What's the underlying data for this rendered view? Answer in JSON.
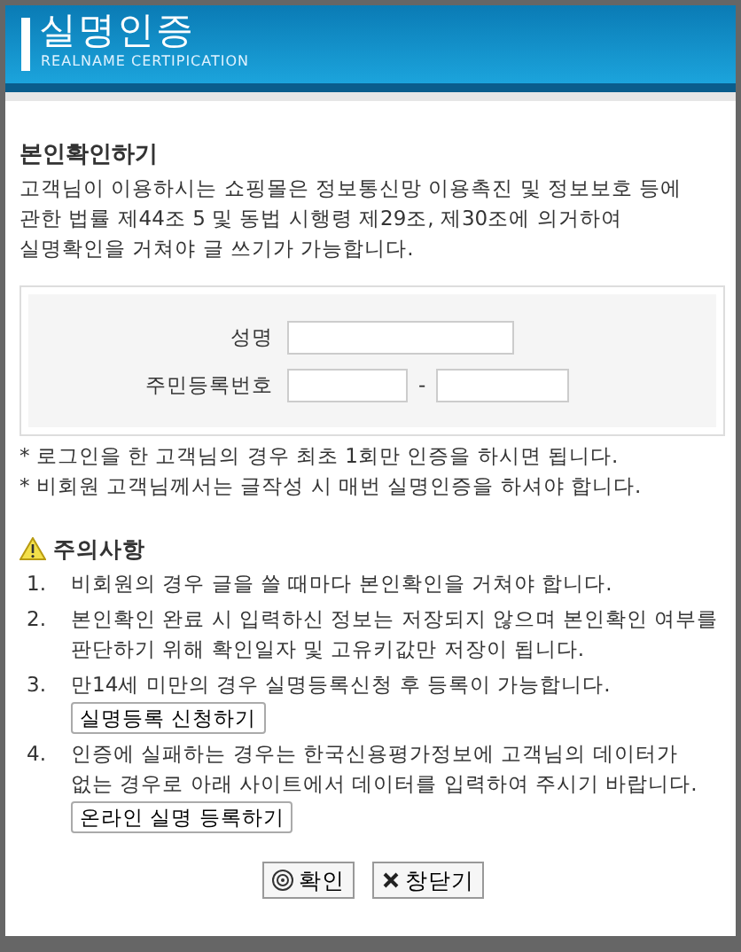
{
  "header": {
    "title": "실명인증",
    "subtitle": "REALNAME CERTIPICATION"
  },
  "section": {
    "heading": "본인확인하기",
    "intro_lines": [
      "고객님이 이용하시는 쇼핑몰은 정보통신망 이용촉진 및 정보보호 등에",
      "관한 법률 제44조 5 및 동법 시행령 제29조, 제30조에 의거하여",
      "실명확인을 거쳐야 글 쓰기가 가능합니다."
    ]
  },
  "form": {
    "name_label": "성명",
    "id_label": "주민등록번호",
    "id_separator": "-"
  },
  "notes": [
    "* 로그인을 한 고객님의 경우 최초 1회만 인증을 하시면 됩니다.",
    "* 비회원 고객님께서는 글작성 시 매번 실명인증을 하셔야 합니다."
  ],
  "caution": {
    "heading": "주의사항",
    "items": [
      {
        "number": "1.",
        "lines": [
          "비회원의 경우 글을 쓸 때마다 본인확인을 거쳐야 합니다."
        ]
      },
      {
        "number": "2.",
        "lines": [
          "본인확인 완료 시 입력하신 정보는 저장되지 않으며 본인확인 여부를",
          "판단하기 위해 확인일자 및 고유키값만 저장이 됩니다."
        ]
      },
      {
        "number": "3.",
        "lines": [
          "만14세 미만의 경우 실명등록신청 후 등록이 가능합니다."
        ],
        "button": "실명등록 신청하기"
      },
      {
        "number": "4.",
        "lines": [
          "인증에 실패하는 경우는 한국신용평가정보에 고객님의 데이터가",
          "없는 경우로 아래 사이트에서 데이터를 입력하여 주시기 바랍니다."
        ],
        "button": "온라인 실명 등록하기"
      }
    ]
  },
  "footer": {
    "buttons": [
      {
        "kind": "confirm",
        "label": "확인"
      },
      {
        "kind": "close",
        "label": "창닫기"
      }
    ]
  }
}
